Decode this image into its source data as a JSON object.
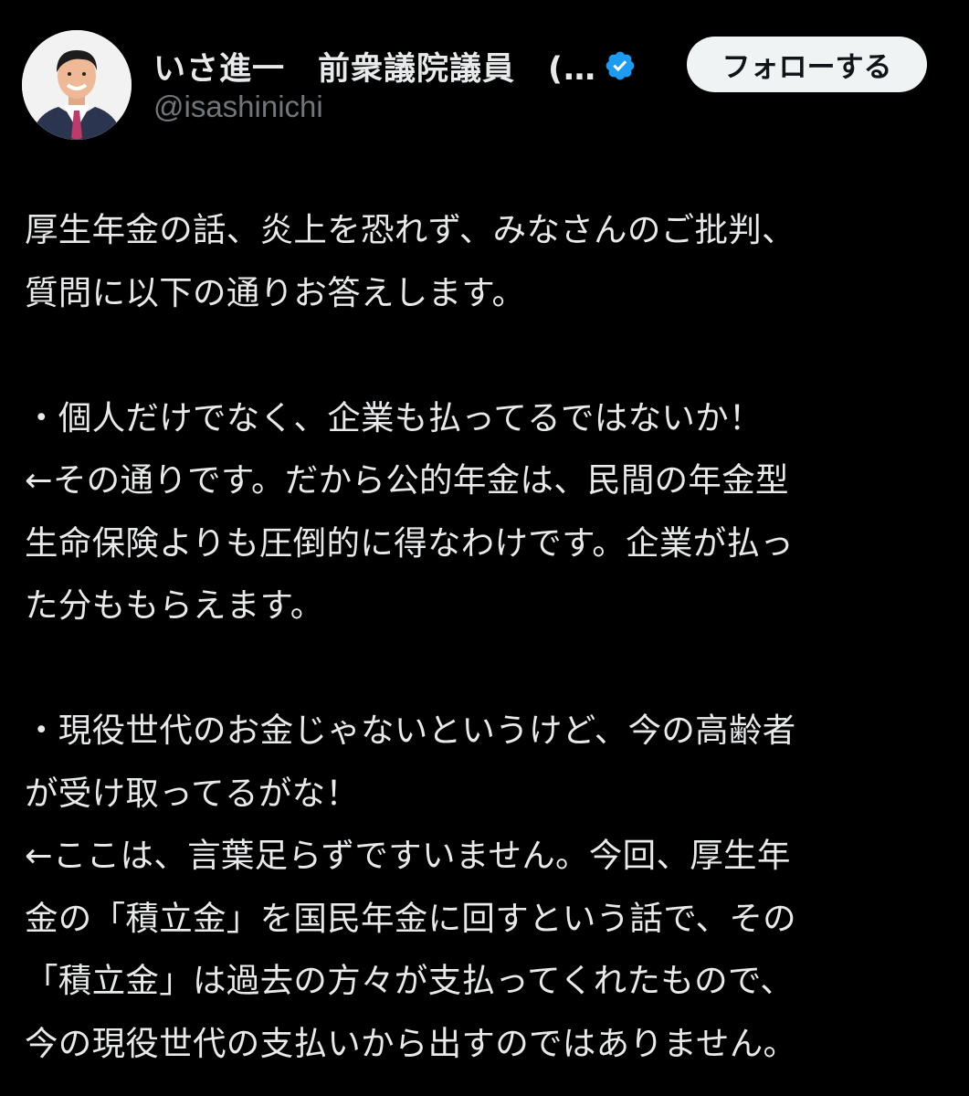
{
  "header": {
    "display_name": "いさ進一　前衆議院議員　(…",
    "handle": "@isashinichi",
    "follow_label": "フォローする",
    "verified_color": "#1d9bf0"
  },
  "post": {
    "lines": [
      "厚生年金の話、炎上を恐れず、みなさんのご批判、",
      "質問に以下の通りお答えします。",
      "",
      "・個人だけでなく、企業も払ってるではないか！",
      "←その通りです。だから公的年金は、民間の年金型",
      "生命保険よりも圧倒的に得なわけです。企業が払っ",
      "た分ももらえます。",
      "",
      "・現役世代のお金じゃないというけど、今の高齢者",
      "が受け取ってるがな！",
      "←ここは、言葉足らずですいません。今回、厚生年",
      "金の「積立金」を国民年金に回すという話で、その",
      "「積立金」は過去の方々が支払ってくれたもので、",
      "今の現役世代の支払いから出すのではありません。"
    ]
  }
}
